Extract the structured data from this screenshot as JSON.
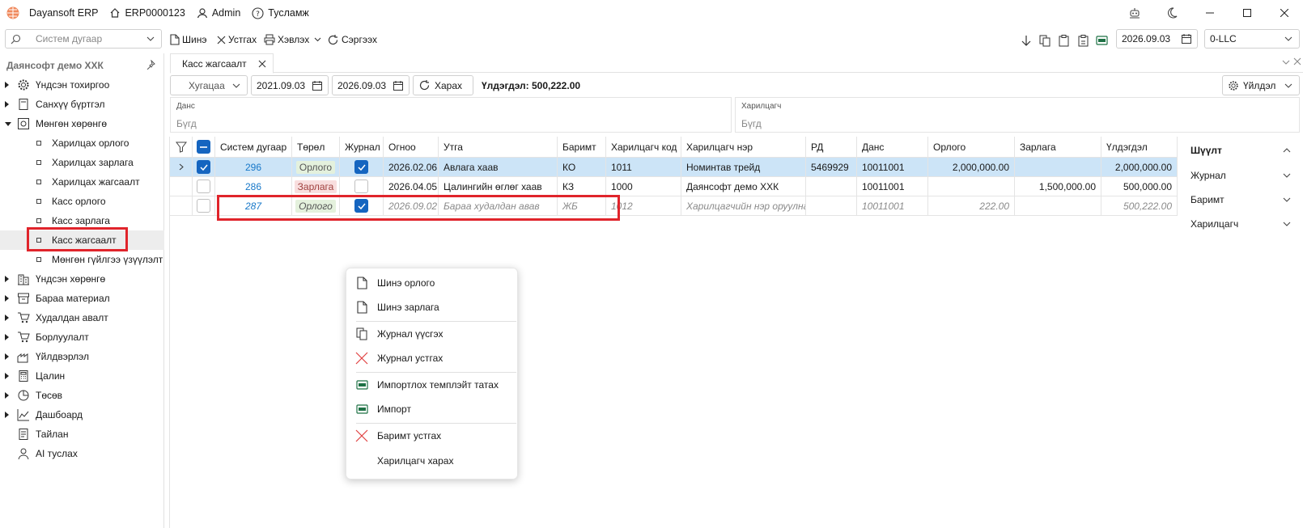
{
  "titlebar": {
    "app_name": "Dayansoft ERP",
    "doc_code": "ERP0000123",
    "user": "Admin",
    "help": "Тусламж"
  },
  "toolbar": {
    "search_placeholder": "Систем дугаар",
    "new_label": "Шинэ",
    "delete_label": "Устгах",
    "print_label": "Хэвлэх",
    "refresh_label": "Сэргээх",
    "date": "2026.09.03",
    "company": "0-LLC"
  },
  "sidebar": {
    "title": "Даянсофт демо ХХК",
    "items": [
      {
        "label": "Үндсэн тохиргоо",
        "icon": "gear-icon"
      },
      {
        "label": "Санхүү бүртгэл",
        "icon": "ledger-icon"
      },
      {
        "label": "Мөнгөн хөрөнгө",
        "icon": "money-icon"
      },
      {
        "label": "Үндсэн хөрөнгө",
        "icon": "building-icon"
      },
      {
        "label": "Бараа материал",
        "icon": "box-icon"
      },
      {
        "label": "Худалдан авалт",
        "icon": "cart-icon"
      },
      {
        "label": "Борлуулалт",
        "icon": "sale-icon"
      },
      {
        "label": "Үйлдвэрлэл",
        "icon": "factory-icon"
      },
      {
        "label": "Цалин",
        "icon": "calculator-icon"
      },
      {
        "label": "Төсөв",
        "icon": "pie-icon"
      },
      {
        "label": "Дашбоард",
        "icon": "chart-icon"
      },
      {
        "label": "Тайлан",
        "icon": "report-icon"
      },
      {
        "label": "AI туслах",
        "icon": "ai-icon"
      }
    ],
    "subitems": [
      "Харилцах орлого",
      "Харилцах зарлага",
      "Харилцах жагсаалт",
      "Касс орлого",
      "Касс зарлага",
      "Касс жагсаалт",
      "Мөнгөн гүйлгээ үзүүлэлт"
    ]
  },
  "tab": {
    "label": "Касс жагсаалт"
  },
  "filter": {
    "period": "Хугацаа",
    "date_from": "2021.09.03",
    "date_to": "2026.09.03",
    "view_label": "Харах",
    "balance": "Үлдэгдэл: 500,222.00",
    "action_label": "Үйлдэл",
    "account_label": "Данс",
    "account_placeholder": "Бүгд",
    "partner_label": "Харилцагч",
    "partner_placeholder": "Бүгд"
  },
  "grid": {
    "columns": [
      "Систем дугаар",
      "Төрөл",
      "Журнал",
      "Огноо",
      "Утга",
      "Баримт",
      "Харилцагч код",
      "Харилцагч нэр",
      "РД",
      "Данс",
      "Орлого",
      "Зарлага",
      "Үлдэгдэл"
    ],
    "rows": [
      {
        "id": "296",
        "type": "Орлого",
        "date": "2026.02.06",
        "desc": "Авлага хаав",
        "doc": "КО",
        "pcode": "1011",
        "pname": "Номинтав трейд",
        "rd": "5469929",
        "account": "10011001",
        "income": "2,000,000.00",
        "expense": "",
        "balance": "2,000,000.00"
      },
      {
        "id": "286",
        "type": "Зарлага",
        "date": "2026.04.05",
        "desc": "Цалингийн өглөг хаав",
        "doc": "КЗ",
        "pcode": "1000",
        "pname": "Даянсофт демо ХХК",
        "rd": "",
        "account": "10011001",
        "income": "",
        "expense": "1,500,000.00",
        "balance": "500,000.00"
      },
      {
        "id": "287",
        "type": "Орлого",
        "date": "2026.09.02",
        "desc": "Бараа худалдан авав",
        "doc": "ЖБ",
        "pcode": "1012",
        "pname": "Харилцагчийн нэр оруулна",
        "rd": "",
        "account": "10011001",
        "income": "222.00",
        "expense": "",
        "balance": "500,222.00"
      }
    ]
  },
  "right_panel": {
    "items": [
      "Шүүлт",
      "Журнал",
      "Баримт",
      "Харилцагч"
    ]
  },
  "context_menu": {
    "items": [
      {
        "label": "Шинэ орлого",
        "icon": "document-icon"
      },
      {
        "label": "Шинэ зарлага",
        "icon": "document-icon"
      },
      {
        "label": "Журнал үүсгэх",
        "icon": "copy-icon"
      },
      {
        "label": "Журнал устгах",
        "icon": "red-x-icon"
      },
      {
        "label": "Импортлох темплэйт татах",
        "icon": "excel-icon"
      },
      {
        "label": "Импорт",
        "icon": "excel-icon"
      },
      {
        "label": "Баримт устгах",
        "icon": "red-x-icon"
      },
      {
        "label": "Харилцагч харах",
        "icon": ""
      }
    ]
  },
  "colors": {
    "accent": "#1565c0",
    "highlight": "#e0242b",
    "selected_row": "#cce4f7"
  }
}
